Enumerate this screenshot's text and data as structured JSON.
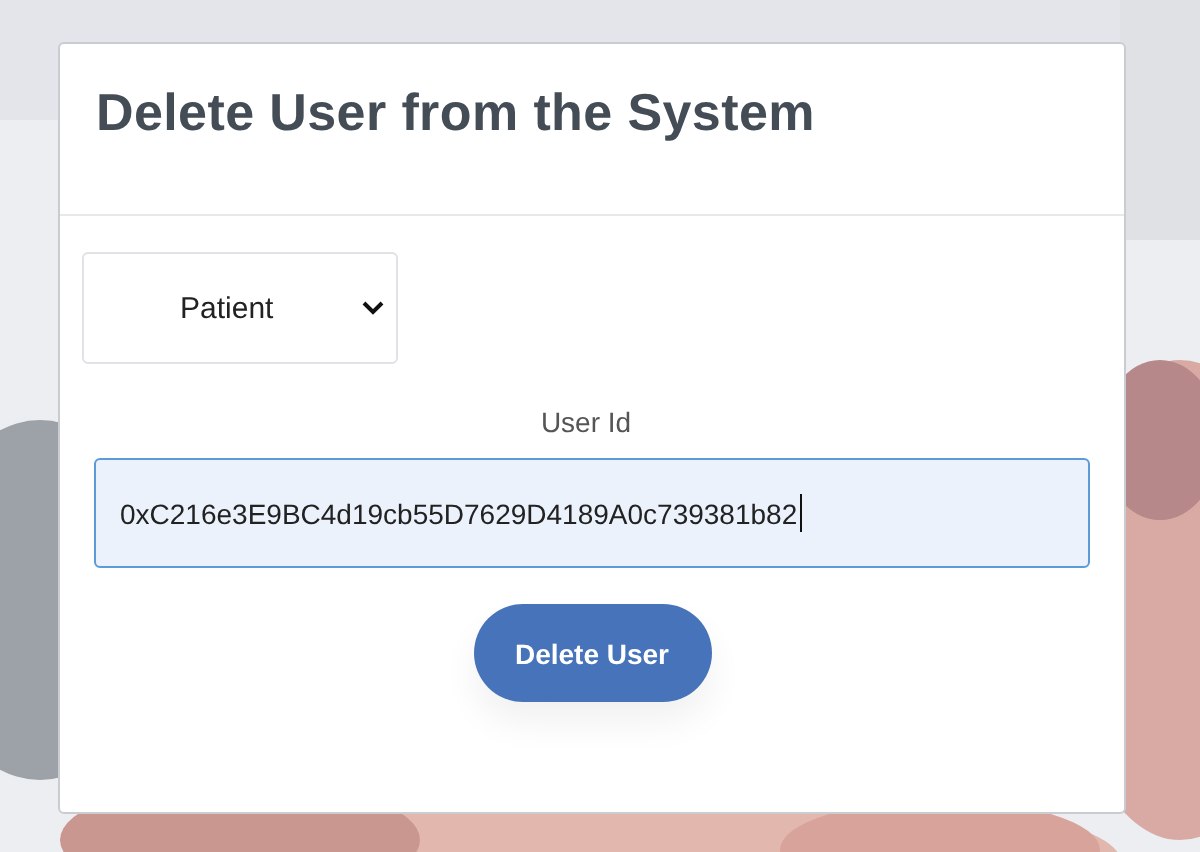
{
  "card": {
    "title": "Delete User from the System",
    "role_select": {
      "value": "Patient"
    },
    "user_id": {
      "label": "User Id",
      "value": "0xC216e3E9BC4d19cb55D7629D4189A0c739381b82",
      "focused": true
    },
    "submit_button": {
      "label": "Delete User"
    }
  }
}
